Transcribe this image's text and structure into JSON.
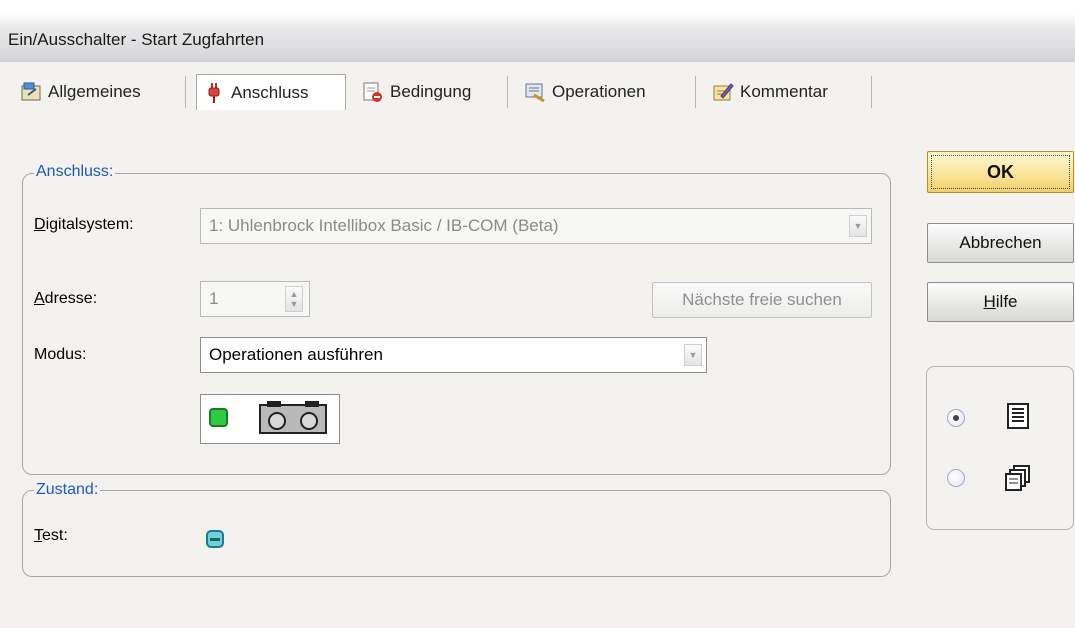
{
  "window": {
    "title": "Ein/Ausschalter - Start Zugfahrten"
  },
  "tabs": [
    {
      "label": "Allgemeines",
      "icon": "properties-icon",
      "active": false
    },
    {
      "label": "Anschluss",
      "icon": "plug-icon",
      "active": true
    },
    {
      "label": "Bedingung",
      "icon": "condition-icon",
      "active": false
    },
    {
      "label": "Operationen",
      "icon": "operations-icon",
      "active": false
    },
    {
      "label": "Kommentar",
      "icon": "comment-icon",
      "active": false
    }
  ],
  "anschluss": {
    "group_title": "Anschluss:",
    "digitalsystem_label": "Digitalsystem:",
    "digitalsystem_value": "1: Uhlenbrock Intellibox Basic / IB-COM (Beta)",
    "adresse_label": "Adresse:",
    "adresse_value": "1",
    "next_free_button": "Nächste freie suchen",
    "modus_label": "Modus:",
    "modus_value": "Operationen ausführen"
  },
  "zustand": {
    "group_title": "Zustand:",
    "test_label": "Test:"
  },
  "buttons": {
    "ok": "OK",
    "cancel": "Abbrechen",
    "help": "Hilfe"
  },
  "view_options": [
    {
      "icon": "single-page-icon",
      "selected": true
    },
    {
      "icon": "multi-page-icon",
      "selected": false
    }
  ],
  "colors": {
    "group_title": "#1a5bbd",
    "led_green": "#2ecc40",
    "default_button": "#fbe59a"
  }
}
